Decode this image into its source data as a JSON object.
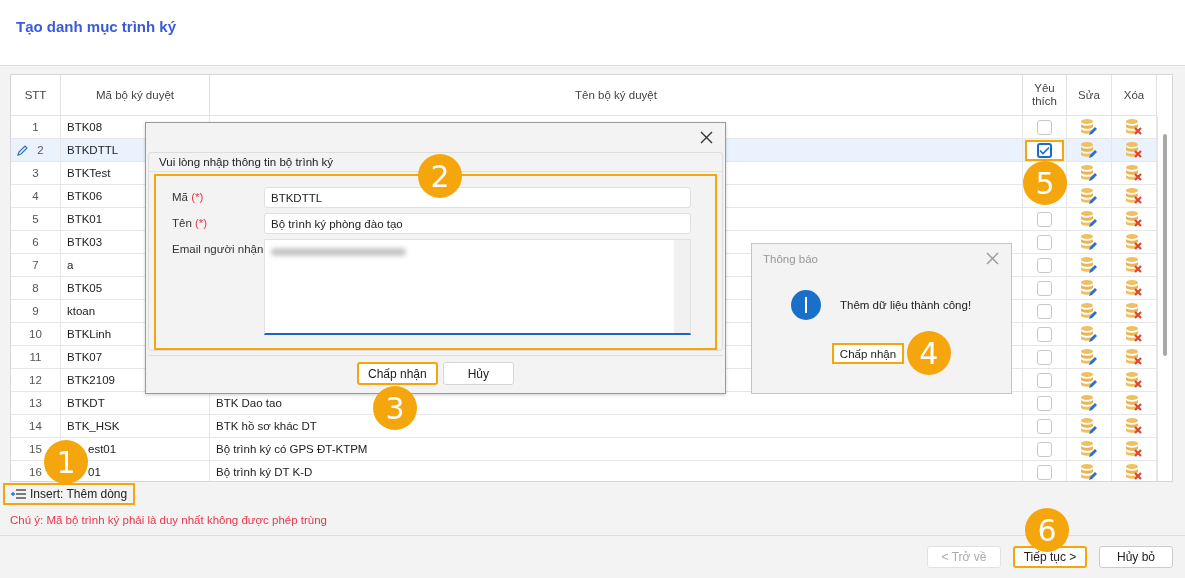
{
  "title": "Tạo danh mục trình ký",
  "table": {
    "columns": [
      {
        "label": "STT",
        "kind": "stt"
      },
      {
        "label": "Mã bộ ký duyệt",
        "kind": "code"
      },
      {
        "label": "Tên bộ ký duyệt",
        "kind": "name"
      },
      {
        "label": "Yêu thích",
        "kind": "favorite"
      },
      {
        "label": "Sửa",
        "kind": "edit"
      },
      {
        "label": "Xóa",
        "kind": "delete"
      }
    ],
    "favorite_badge": "5",
    "rows": [
      {
        "stt": "1",
        "code": "BTK08",
        "favorite": false,
        "selected": false,
        "editing": false
      },
      {
        "stt": "2",
        "code": "BTKDTTL",
        "favorite": true,
        "selected": true,
        "editing": true
      },
      {
        "stt": "3",
        "code": "BTKTest",
        "selected": false,
        "editing": false
      },
      {
        "stt": "4",
        "code": "BTK06",
        "selected": false,
        "editing": false
      },
      {
        "stt": "5",
        "code": "BTK01",
        "favorite": false,
        "selected": false,
        "editing": false
      },
      {
        "stt": "6",
        "code": "BTK03",
        "favorite": false,
        "selected": false,
        "editing": false
      },
      {
        "stt": "7",
        "code": "a",
        "favorite": false,
        "selected": false,
        "editing": false
      },
      {
        "stt": "8",
        "code": "BTK05",
        "favorite": false,
        "selected": false,
        "editing": false
      },
      {
        "stt": "9",
        "code": "ktoan",
        "favorite": false,
        "selected": false,
        "editing": false
      },
      {
        "stt": "10",
        "code": "BTKLinh",
        "favorite": false,
        "selected": false,
        "editing": false
      },
      {
        "stt": "11",
        "code": "BTK07",
        "favorite": false,
        "selected": false,
        "editing": false
      },
      {
        "stt": "12",
        "code": "BTK2109",
        "favorite": false,
        "selected": false,
        "editing": false
      },
      {
        "stt": "13",
        "code": "BTKDT",
        "name": "BTK Dao tao",
        "favorite": false,
        "selected": false,
        "editing": false
      },
      {
        "stt": "14",
        "code": "BTK_HSK",
        "name": "BTK hồ sơ khác DT",
        "favorite": false,
        "selected": false,
        "editing": false
      },
      {
        "stt": "15",
        "code": "est01",
        "kind": "covered",
        "name": "Bộ trình ký có GPS ĐT-KTPM",
        "favorite": false,
        "selected": false,
        "editing": false
      },
      {
        "stt": "16",
        "code": "01",
        "kind": "covered",
        "name": "Bộ trình ký DT K-D",
        "favorite": false,
        "selected": false,
        "editing": false
      }
    ]
  },
  "form_dialog": {
    "group_title": "Vui lòng nhập thông tin bộ trình ký",
    "badge": "2",
    "fields": [
      {
        "kind": "input",
        "label": "Mã",
        "required_mark": "(*)",
        "value": "BTKDTTL"
      },
      {
        "kind": "input",
        "label": "Tên",
        "required_mark": "(*)",
        "value": "Bộ trình ký phòng đào tạo"
      },
      {
        "kind": "textarea",
        "label": "Email người nhận",
        "blurred": true
      }
    ],
    "buttons": [
      {
        "label": "Chấp nhận",
        "highlighted": true
      },
      {
        "label": "Hủy",
        "highlighted": false
      }
    ],
    "buttons_badge": "3"
  },
  "message_dialog": {
    "title": "Thông báo",
    "text": "Thêm dữ liệu thành công!",
    "button": "Chấp nhận",
    "badge": "4"
  },
  "insert": {
    "label": "Insert: Thêm dòng",
    "badge": "1"
  },
  "note": "Chú ý: Mã bộ trình ký phải là duy nhất không được phép trùng",
  "footer_buttons": [
    {
      "label": "< Trở về",
      "disabled": true,
      "highlighted": false
    },
    {
      "label": "Tiếp tục >",
      "disabled": false,
      "highlighted": true,
      "badge": "6"
    },
    {
      "label": "Hủy bỏ",
      "disabled": false,
      "highlighted": false
    }
  ]
}
